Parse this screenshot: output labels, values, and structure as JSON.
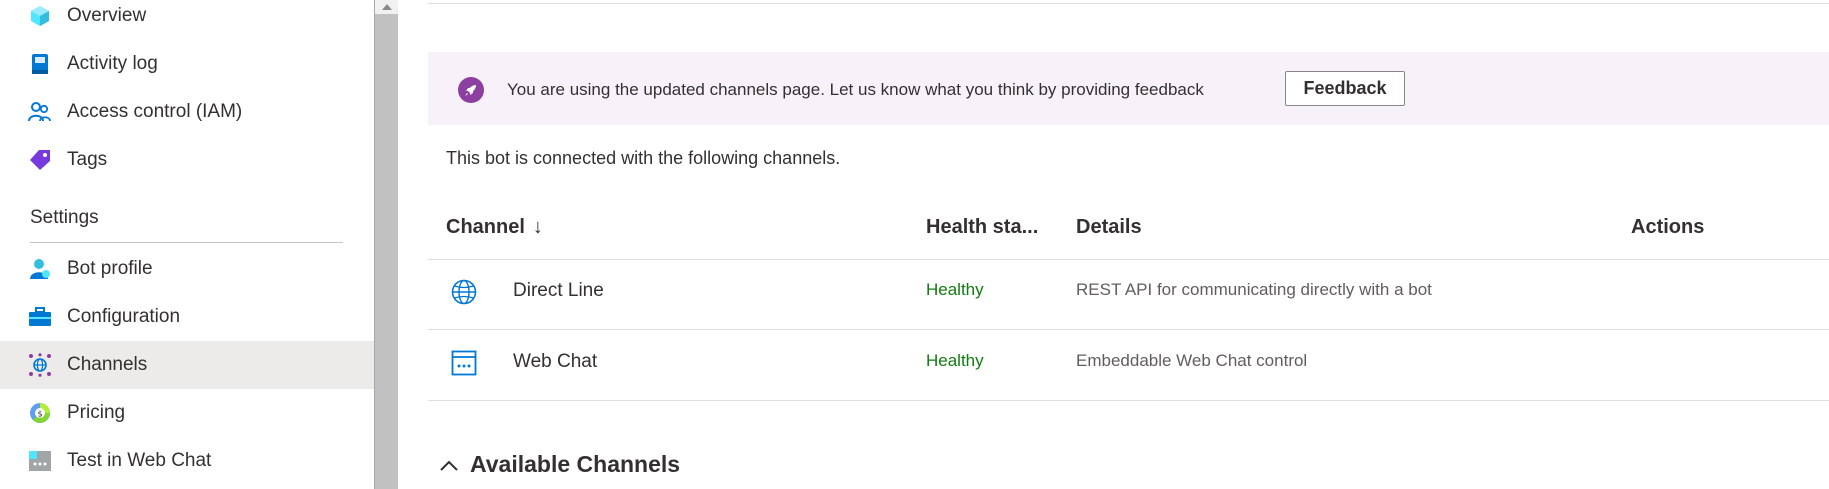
{
  "sidebar": {
    "items": [
      {
        "label": "Overview",
        "icon": "cube-icon"
      },
      {
        "label": "Activity log",
        "icon": "book-icon"
      },
      {
        "label": "Access control (IAM)",
        "icon": "people-icon"
      },
      {
        "label": "Tags",
        "icon": "tag-icon"
      }
    ],
    "section_title": "Settings",
    "settings_items": [
      {
        "label": "Bot profile",
        "icon": "person-icon"
      },
      {
        "label": "Configuration",
        "icon": "toolbox-icon"
      },
      {
        "label": "Channels",
        "icon": "channels-icon",
        "selected": true
      },
      {
        "label": "Pricing",
        "icon": "coin-icon"
      },
      {
        "label": "Test in Web Chat",
        "icon": "web-chat-icon"
      }
    ]
  },
  "banner": {
    "icon": "rocket-icon",
    "text": "You are using the updated channels page. Let us know what you think by providing feedback",
    "button_label": "Feedback"
  },
  "intro_text": "This bot is connected with the following channels.",
  "table": {
    "headers": {
      "channel": "Channel",
      "sort_glyph": "↓",
      "health": "Health sta...",
      "details": "Details",
      "actions": "Actions"
    },
    "rows": [
      {
        "icon": "globe-icon",
        "name": "Direct Line",
        "health": "Healthy",
        "details": "REST API for communicating directly with a bot"
      },
      {
        "icon": "web-chat-window-icon",
        "name": "Web Chat",
        "health": "Healthy",
        "details": "Embeddable Web Chat control"
      }
    ]
  },
  "available_channels_label": "Available Channels",
  "colors": {
    "healthy": "#107c10",
    "banner_bg": "#f7f2fa",
    "banner_icon": "#8c3fa0",
    "selected_nav_bg": "#edebe9",
    "icon_blue": "#0078d4"
  }
}
